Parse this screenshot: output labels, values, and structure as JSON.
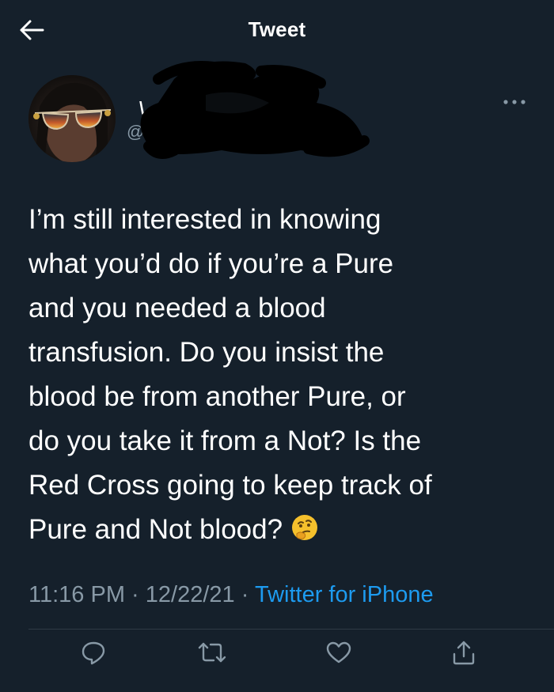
{
  "header": {
    "title": "Tweet",
    "back_icon": "arrow-left-icon"
  },
  "author": {
    "name_visible": "\\",
    "handle_visible": "@",
    "more_icon": "more-horizontal-icon"
  },
  "tweet": {
    "text": "I’m still interested in knowing\nwhat you’d do if you’re a Pure\nand you needed a blood\ntransfusion. Do you insist the\nblood be from another Pure, or\ndo you take it from a Not? Is the\nRed Cross going to keep track of\nPure and Not blood?",
    "emoji": "🤔",
    "time": "11:16 PM",
    "date": "12/22/21",
    "separator": "·",
    "source": "Twitter for iPhone"
  },
  "actions": {
    "reply_icon": "reply-icon",
    "retweet_icon": "retweet-icon",
    "like_icon": "heart-icon",
    "share_icon": "share-icon"
  },
  "colors": {
    "background": "#15202b",
    "text": "#ffffff",
    "secondary": "#8899a6",
    "link": "#1d9bf0"
  }
}
